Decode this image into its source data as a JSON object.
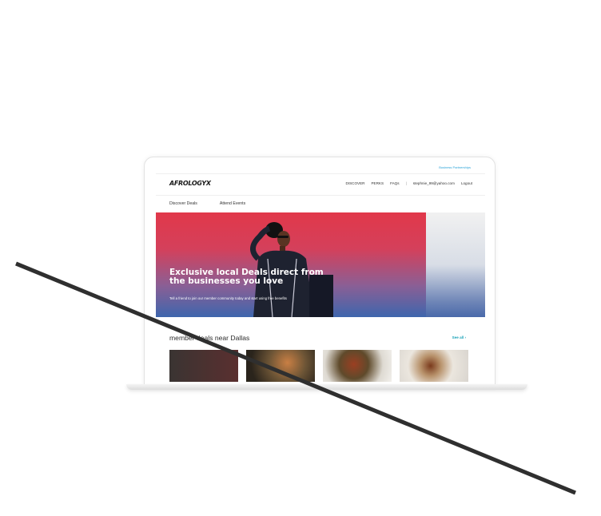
{
  "site": {
    "top_link": "Business Partnerships",
    "logo": "AFROLOGYX",
    "nav": {
      "discover": "DISCOVER",
      "perks": "PERKS",
      "faqs": "FAQs",
      "separator": "|",
      "email": "stephnie_99@yahoo.com",
      "logout": "Logout"
    },
    "subnav": {
      "discover_deals": "Discover Deals",
      "attend_events": "Attend Events"
    },
    "hero": {
      "title": "Exclusive local Deals direct from the businesses you love",
      "subtitle": "Tell a friend to join our member community today and start using free benefits"
    },
    "deals": {
      "title": "member deals near Dallas",
      "see_all": "See all ›"
    }
  },
  "colors": {
    "accent_teal": "#1ba3b8",
    "link_blue": "#2aa3d8",
    "hero_red": "#e1384a",
    "hero_blue": "#3e66ad"
  }
}
